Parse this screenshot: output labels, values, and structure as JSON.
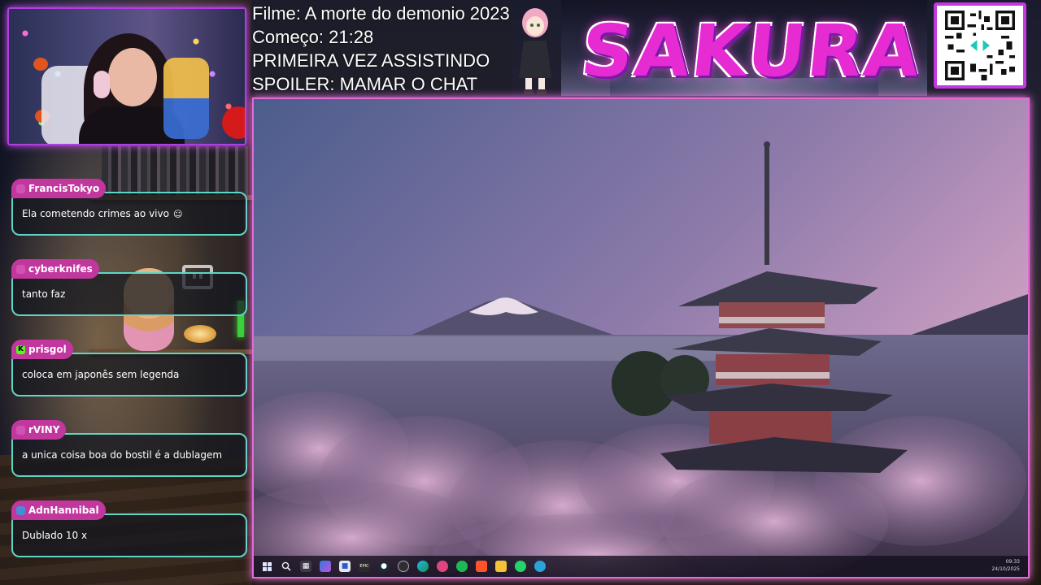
{
  "stream_info": {
    "film": "Filme: A morte do demonio 2023",
    "start": "Começo: 21:28",
    "note": "PRIMEIRA VEZ ASSISTINDO",
    "spoiler": "SPOILER: MAMAR O CHAT"
  },
  "brand": {
    "title": "SAKURA",
    "color": "#e62bd2"
  },
  "chat": {
    "messages": [
      {
        "user": "FrancisTokyo",
        "badge": "purple",
        "text": "Ela cometendo crimes ao vivo"
      },
      {
        "user": "cyberknifes",
        "badge": "purple",
        "text": "tanto faz"
      },
      {
        "user": "prisgol",
        "badge": "kick",
        "badge_glyph": "K",
        "text": "coloca em japonês sem legenda"
      },
      {
        "user": "rVINY",
        "badge": "purple",
        "text": "a unica coisa boa do bostil é a dublagem"
      },
      {
        "user": "AdnHannibal",
        "badge": "person",
        "text": "Dublado 10 x"
      }
    ]
  },
  "taskbar": {
    "icons": [
      "windows-start-icon",
      "search-icon",
      "task-view-icon",
      "copilot-icon",
      "store-icon",
      "epic-games-icon",
      "steam-icon",
      "obs-icon",
      "edge-icon",
      "discord-icon",
      "spotify-icon",
      "brave-icon",
      "file-explorer-icon",
      "whatsapp-icon",
      "telegram-icon"
    ],
    "epic_label": "EPIC",
    "time": "09:33",
    "date": "24/10/2025"
  },
  "colors": {
    "chat_border": "#5fd6c5",
    "username_bg": "#c2379e",
    "frame_accent": "#e46ad8"
  }
}
